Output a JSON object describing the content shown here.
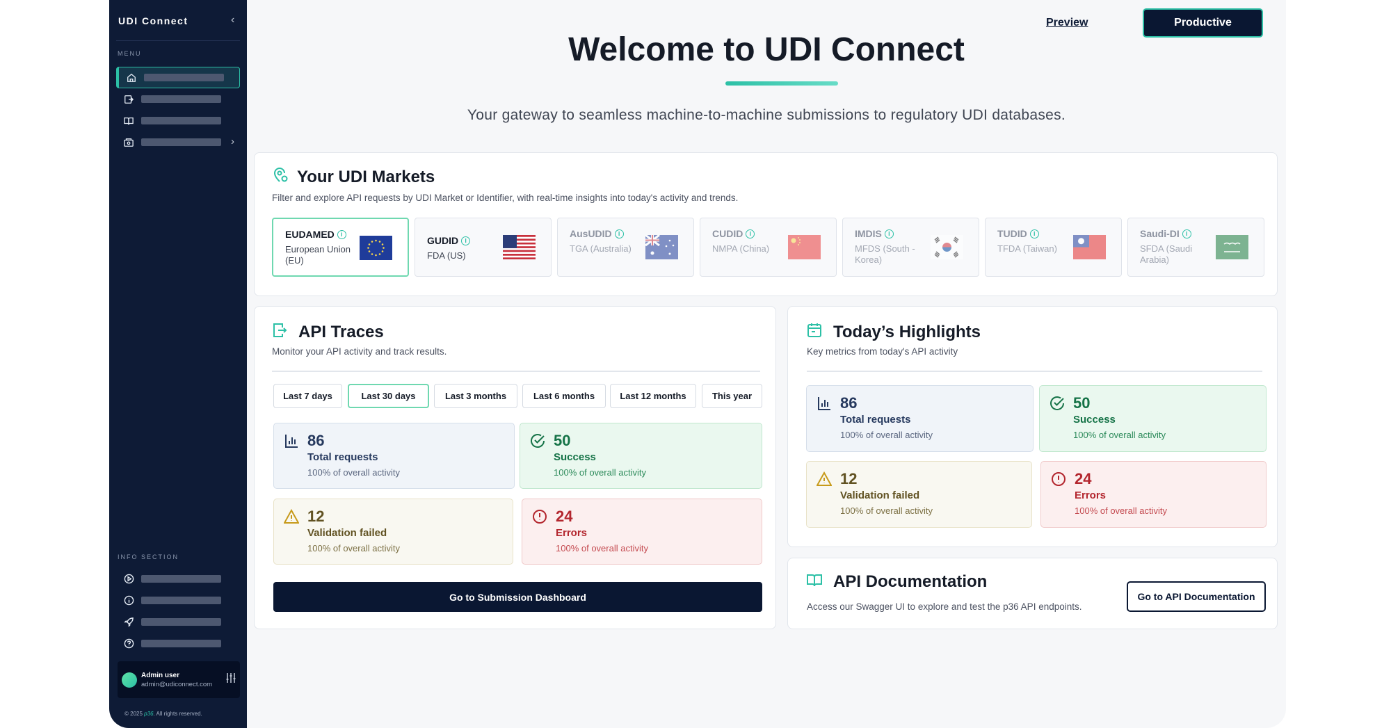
{
  "sidebar": {
    "title": "UDI Connect",
    "menu_label": "MENU",
    "info_label": "INFO SECTION",
    "user": {
      "name": "Admin user",
      "email": "admin@udiconnect.com"
    },
    "footer": {
      "year": "2025",
      "brand": "p36",
      "rights": ". All rights reserved."
    }
  },
  "header": {
    "preview_label": "Preview",
    "environment_label": "Productive",
    "title": "Welcome to UDI Connect",
    "subtitle": "Your gateway to seamless machine-to-machine submissions to regulatory UDI databases."
  },
  "markets": {
    "title": "Your UDI Markets",
    "description": "Filter and explore API requests by UDI Market or Identifier, with real-time insights into today's activity and trends.",
    "items": [
      {
        "name": "EUDAMED",
        "region": "European Union (EU)"
      },
      {
        "name": "GUDID",
        "region": "FDA (US)"
      },
      {
        "name": "AusUDID",
        "region": "TGA (Australia)"
      },
      {
        "name": "CUDID",
        "region": "NMPA (China)"
      },
      {
        "name": "IMDIS",
        "region": "MFDS (South - Korea)"
      },
      {
        "name": "TUDID",
        "region": "TFDA (Taiwan)"
      },
      {
        "name": "Saudi-DI",
        "region": "SFDA (Saudi Arabia)"
      }
    ]
  },
  "api_traces": {
    "title": "API Traces",
    "description": "Monitor your API activity and track results.",
    "ranges": [
      "Last 7 days",
      "Last 30 days",
      "Last 3 months",
      "Last 6 months",
      "Last 12 months",
      "This year"
    ],
    "active_range": "Last 30 days",
    "stats": [
      {
        "value": "86",
        "label": "Total requests",
        "sub": "100% of overall activity"
      },
      {
        "value": "50",
        "label": "Success",
        "sub": "100% of overall activity"
      },
      {
        "value": "12",
        "label": "Validation failed",
        "sub": "100% of overall activity"
      },
      {
        "value": "24",
        "label": "Errors",
        "sub": "100% of overall activity"
      }
    ],
    "button_label": "Go to Submission Dashboard"
  },
  "highlights": {
    "title": "Today’s Highlights",
    "description": "Key metrics from today's API activity",
    "stats": [
      {
        "value": "86",
        "label": "Total requests",
        "sub": "100% of overall activity"
      },
      {
        "value": "50",
        "label": "Success",
        "sub": "100% of overall activity"
      },
      {
        "value": "12",
        "label": "Validation failed",
        "sub": "100% of overall activity"
      },
      {
        "value": "24",
        "label": "Errors",
        "sub": "100% of overall activity"
      }
    ]
  },
  "api_docs": {
    "title": "API Documentation",
    "description": "Access our Swagger UI to explore and test the p36 API endpoints.",
    "button_label": "Go to API Documentation"
  },
  "colors": {
    "sidebar_bg": "#0e1b36",
    "accent": "#2cc0a6",
    "primary_button": "#0a1732"
  }
}
